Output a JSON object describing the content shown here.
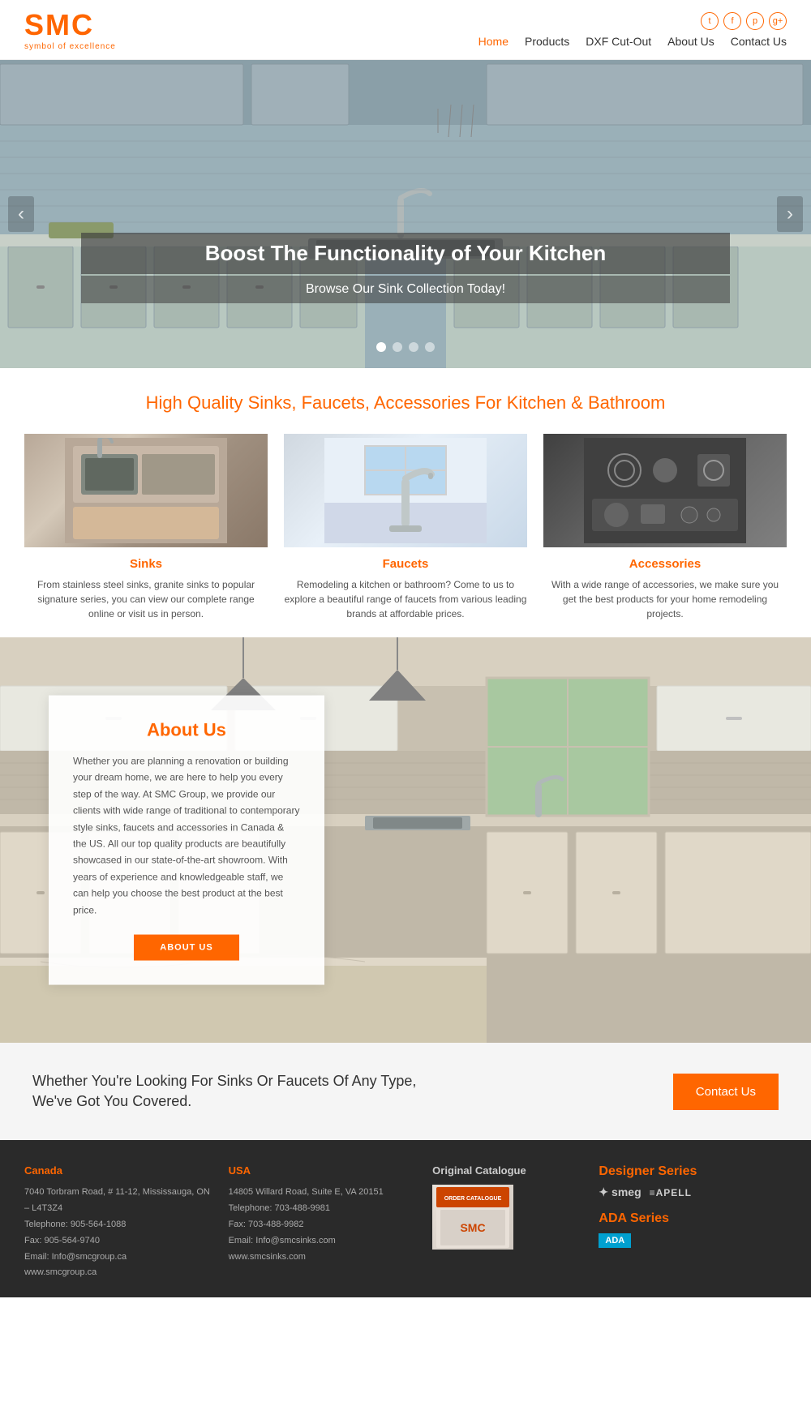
{
  "header": {
    "logo": "SMC",
    "logo_sub": "symbol of excellence",
    "social": [
      "t",
      "f",
      "p",
      "g+"
    ],
    "nav": [
      {
        "label": "Home",
        "active": true
      },
      {
        "label": "Products",
        "active": false
      },
      {
        "label": "DXF Cut-Out",
        "active": false
      },
      {
        "label": "About Us",
        "active": false
      },
      {
        "label": "Contact Us",
        "active": false
      }
    ]
  },
  "hero": {
    "title": "Boost The Functionality of Your Kitchen",
    "subtitle": "Browse Our Sink Collection Today!",
    "arrow_left": "‹",
    "arrow_right": "›",
    "dots": [
      true,
      false,
      false,
      false
    ]
  },
  "products": {
    "section_title": "High Quality Sinks, Faucets, Accessories For Kitchen & Bathroom",
    "items": [
      {
        "name": "Sinks",
        "desc": "From stainless steel sinks, granite sinks to popular signature series, you can view our complete range online or visit us in person."
      },
      {
        "name": "Faucets",
        "desc": "Remodeling a kitchen or bathroom? Come to us to explore a beautiful range of faucets from various leading brands at affordable prices."
      },
      {
        "name": "Accessories",
        "desc": "With a wide range of accessories, we make sure you get the best products for your home remodeling projects."
      }
    ]
  },
  "about": {
    "title": "About Us",
    "text": "Whether you are planning a renovation or building your dream home, we are here to help you every step of the way. At SMC Group, we provide our clients with wide range of traditional to contemporary style sinks, faucets and accessories in Canada & the US. All our top quality products are beautifully showcased in our state-of-the-art showroom. With years of experience and knowledgeable staff, we can help you choose the best product at the best price.",
    "button": "ABOUT US"
  },
  "cta": {
    "text": "Whether You're Looking For Sinks Or Faucets Of Any Type, We've Got You Covered.",
    "button": "Contact Us"
  },
  "footer": {
    "canada": {
      "title": "Canada",
      "address": "7040 Torbram Road, # 11-12, Mississauga, ON – L4T3Z4",
      "phone": "Telephone: 905-564-1088",
      "fax": "Fax: 905-564-9740",
      "email": "Email: Info@smcgroup.ca",
      "website": "www.smcgroup.ca"
    },
    "usa": {
      "title": "USA",
      "address": "14805 Willard Road, Suite E, VA 20151",
      "phone": "Telephone: 703-488-9981",
      "fax": "Fax: 703-488-9982",
      "email": "Email: Info@smcsinks.com",
      "website": "www.smcsinks.com"
    },
    "catalogue": {
      "title": "Original Catalogue",
      "label": "ORDER CATALOGUE",
      "brand": "SMC"
    },
    "brands": {
      "designer_title": "Designer Series",
      "smeg": "✦ smeg",
      "apell": "≡APELL",
      "ada_title": "ADA Series",
      "ada_badge": "ADA"
    }
  }
}
